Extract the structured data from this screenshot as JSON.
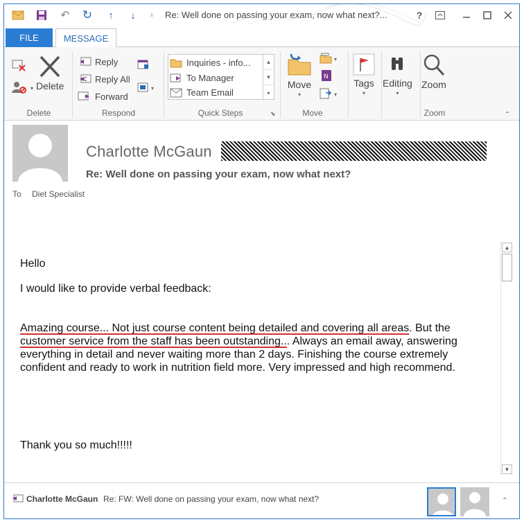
{
  "window": {
    "title": "Re: Well done on passing your exam, now what next?...",
    "help": "?",
    "accent": "#2b7cd3"
  },
  "tabs": {
    "file": "FILE",
    "message": "MESSAGE"
  },
  "ribbon": {
    "delete": {
      "label": "Delete",
      "group": "Delete"
    },
    "respond": {
      "reply": "Reply",
      "reply_all": "Reply All",
      "forward": "Forward",
      "group": "Respond"
    },
    "quick_steps": {
      "items": [
        "Inquiries - info...",
        "To Manager",
        "Team Email"
      ],
      "group": "Quick Steps"
    },
    "move": {
      "label": "Move",
      "group": "Move"
    },
    "tags": {
      "label": "Tags"
    },
    "editing": {
      "label": "Editing"
    },
    "zoom": {
      "label": "Zoom",
      "group": "Zoom"
    }
  },
  "message": {
    "sender": "Charlotte McGaun",
    "subject": "Re: Well done on passing your exam, now what next?",
    "to_label": "To",
    "to": "Diet Specialist",
    "body": {
      "greeting": "Hello",
      "intro": "I would like to provide verbal feedback:",
      "para_ul1": "Amazing course... Not just course content being detailed and covering all areas",
      "para_mid": ". But the ",
      "para_ul2": "customer service from the staff has been outstanding..",
      "para_rest1": ". Always an email away, answering",
      "para_line3": "everything in detail and never waiting more than 2 days. Finishing the course extremely",
      "para_line4": "confident and ready to work in nutrition field more. Very impressed and high recommend.",
      "closing": "Thank you so much!!!!!"
    }
  },
  "people_pane": {
    "name": "Charlotte McGaun",
    "subject": "Re: FW: Well done on passing your exam, now what next?"
  }
}
